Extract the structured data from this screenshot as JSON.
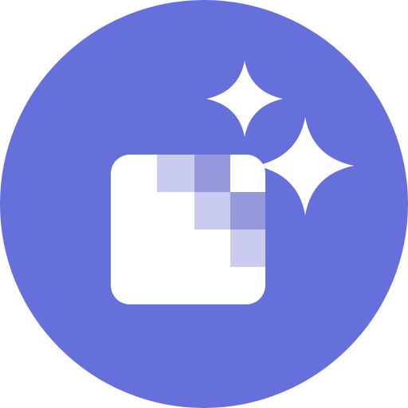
{
  "icon": {
    "name": "image-enhance-sparkle-icon",
    "colors": {
      "background": "#6670DB",
      "foreground": "#FFFFFF",
      "pixel_light": "#C9CCEF",
      "pixel_mid": "#9599DC"
    },
    "glyphs": [
      "photo-square-icon",
      "pixel-blocks",
      "sparkle-large-icon",
      "sparkle-small-icon"
    ]
  }
}
